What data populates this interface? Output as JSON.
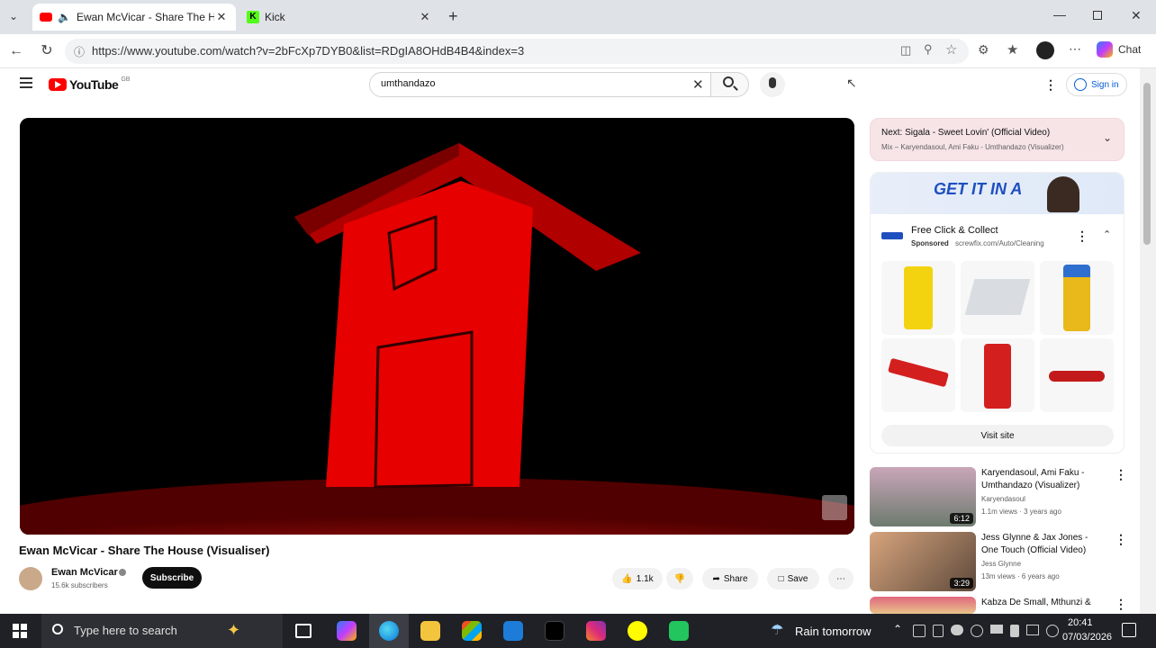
{
  "browser": {
    "tabs": [
      {
        "title": "Ewan McVicar - Share The Hou",
        "active": true
      },
      {
        "title": "Kick",
        "active": false
      }
    ],
    "url": "https://www.youtube.com/watch?v=2bFcXp7DYB0&list=RDgIA8OHdB4B4&index=3",
    "chat_label": "Chat"
  },
  "youtube": {
    "logo_text": "YouTube",
    "logo_region": "GB",
    "search_value": "umthandazo",
    "sign_in": "Sign in"
  },
  "video": {
    "title": "Ewan McVicar - Share The House (Visualiser)",
    "channel": "Ewan McVicar",
    "subscribers": "15.6k subscribers",
    "subscribe_label": "Subscribe",
    "likes": "1.1k",
    "share_label": "Share",
    "save_label": "Save"
  },
  "up_next": {
    "title": "Next: Sigala - Sweet Lovin' (Official Video)",
    "subtitle": "Mix – Karyendasoul, Ami Faku - Umthandazo (Visualizer)"
  },
  "ad": {
    "banner_text": "GET IT IN A",
    "advertiser_title": "Free Click & Collect",
    "sponsored": "Sponsored",
    "ad_url": "screwfix.com/Auto/Cleaning",
    "visit_label": "Visit site"
  },
  "recommendations": [
    {
      "title": "Karyendasoul, Ami Faku - Umthandazo (Visualizer)",
      "channel": "Karyendasoul",
      "meta": "1.1m views · 3 years ago",
      "duration": "6:12",
      "color": "#7a8a9a"
    },
    {
      "title": "Jess Glynne & Jax Jones - One Touch (Official Video)",
      "channel": "Jess Glynne",
      "meta": "13m views · 6 years ago",
      "duration": "3:29",
      "color": "#b98a6a"
    },
    {
      "title": "Kabza De Small, Mthunzi &",
      "channel": "",
      "meta": "",
      "duration": "",
      "color": "#d9b37a"
    }
  ],
  "taskbar": {
    "search_placeholder": "Type here to search",
    "weather": "Rain tomorrow",
    "time": "20:41",
    "date": "07/03/2026"
  },
  "colors": {
    "yt_red": "#ff0000",
    "player_red": "#e00000"
  }
}
